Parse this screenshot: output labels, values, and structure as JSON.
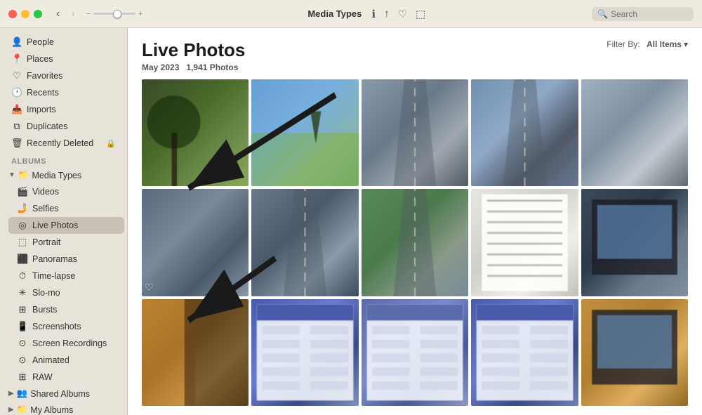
{
  "window": {
    "title": "Media Types"
  },
  "toolbar": {
    "back_label": "‹",
    "forward_label": "›",
    "search_placeholder": "Search"
  },
  "sidebar": {
    "library_items": [
      {
        "id": "people",
        "label": "People",
        "icon": "👤"
      },
      {
        "id": "places",
        "label": "Places",
        "icon": "📍"
      },
      {
        "id": "favorites",
        "label": "Favorites",
        "icon": "♡"
      },
      {
        "id": "recents",
        "label": "Recents",
        "icon": "🕐"
      },
      {
        "id": "imports",
        "label": "Imports",
        "icon": "📥"
      },
      {
        "id": "duplicates",
        "label": "Duplicates",
        "icon": "⧉"
      },
      {
        "id": "recently-deleted",
        "label": "Recently Deleted",
        "icon": "🗑"
      }
    ],
    "albums_section": "Albums",
    "media_types_group": "Media Types",
    "media_types_items": [
      {
        "id": "videos",
        "label": "Videos",
        "icon": "🎬"
      },
      {
        "id": "selfies",
        "label": "Selfies",
        "icon": "🤳"
      },
      {
        "id": "live-photos",
        "label": "Live Photos",
        "icon": "◎",
        "active": true
      },
      {
        "id": "portrait",
        "label": "Portrait",
        "icon": "⬚"
      },
      {
        "id": "panoramas",
        "label": "Panoramas",
        "icon": "⬛"
      },
      {
        "id": "time-lapse",
        "label": "Time-lapse",
        "icon": "⏱"
      },
      {
        "id": "slo-mo",
        "label": "Slo-mo",
        "icon": "✳"
      },
      {
        "id": "bursts",
        "label": "Bursts",
        "icon": "⊞"
      },
      {
        "id": "screenshots",
        "label": "Screenshots",
        "icon": "📱"
      },
      {
        "id": "screen-recordings",
        "label": "Screen Recordings",
        "icon": "⊙"
      },
      {
        "id": "animated",
        "label": "Animated",
        "icon": "⊙"
      },
      {
        "id": "raw",
        "label": "RAW",
        "icon": "⊞"
      }
    ],
    "shared_albums": "Shared Albums",
    "my_albums": "My Albums"
  },
  "content": {
    "title": "Live Photos",
    "date": "May 2023",
    "count": "1,941 Photos",
    "filter_label": "Filter By:",
    "filter_value": "All Items"
  },
  "photos": {
    "grid": [
      {
        "id": 1,
        "type": "tree",
        "colors": [
          "#3a4a2a",
          "#4a6a2a",
          "#6a8a4a",
          "#8aaa5a"
        ]
      },
      {
        "id": 2,
        "type": "sky_field",
        "colors": [
          "#6a9fcc",
          "#8abfe0",
          "#a8c890",
          "#88b870"
        ]
      },
      {
        "id": 3,
        "type": "road_overcast",
        "colors": [
          "#8a9aaa",
          "#6a7a8a",
          "#a0a8b0",
          "#505860"
        ]
      },
      {
        "id": 4,
        "type": "road_clear",
        "colors": [
          "#7090b0",
          "#90aac8",
          "#505868",
          "#687890"
        ]
      },
      {
        "id": 5,
        "type": "rain_wiper",
        "colors": [
          "#a0b0c0",
          "#8090a0",
          "#c0c8d0",
          "#606870"
        ]
      },
      {
        "id": 6,
        "type": "dash_rain",
        "colors": [
          "#5a6a7a",
          "#7a8a9a",
          "#4a5a6a",
          "#8a9aaa"
        ]
      },
      {
        "id": 7,
        "type": "road_steering",
        "colors": [
          "#6a7a8a",
          "#4a5a6a",
          "#8a9aaa",
          "#3a4a5a"
        ]
      },
      {
        "id": 8,
        "type": "road_green_sign",
        "colors": [
          "#5a8a5a",
          "#4a7a4a",
          "#8a9a8a",
          "#7a8a9a"
        ]
      },
      {
        "id": 9,
        "type": "document",
        "colors": [
          "#e8e8e0",
          "#d0d0c8",
          "#f0f0e8",
          "#c0c0b8"
        ]
      },
      {
        "id": 10,
        "type": "monitor_dark",
        "colors": [
          "#3a4a5a",
          "#2a3a4a",
          "#6a7a8a",
          "#8090a0"
        ]
      },
      {
        "id": 11,
        "type": "interior_warm",
        "colors": [
          "#c0903a",
          "#a07028",
          "#e0b060",
          "#8a6020"
        ]
      },
      {
        "id": 12,
        "type": "screen_ui",
        "colors": [
          "#4a5aaa",
          "#6a7acc",
          "#3a4a8a",
          "#8090c0"
        ]
      },
      {
        "id": 13,
        "type": "screen_ui2",
        "colors": [
          "#5a6aaa",
          "#7a8acc",
          "#4a5a9a",
          "#9098c8"
        ]
      },
      {
        "id": 14,
        "type": "screen_ui3",
        "colors": [
          "#4a5aaa",
          "#6a7acc",
          "#3a4a8a",
          "#7080b8"
        ]
      },
      {
        "id": 15,
        "type": "monitor_warm",
        "colors": [
          "#c09040",
          "#b08030",
          "#e0b060",
          "#906820"
        ]
      }
    ]
  }
}
